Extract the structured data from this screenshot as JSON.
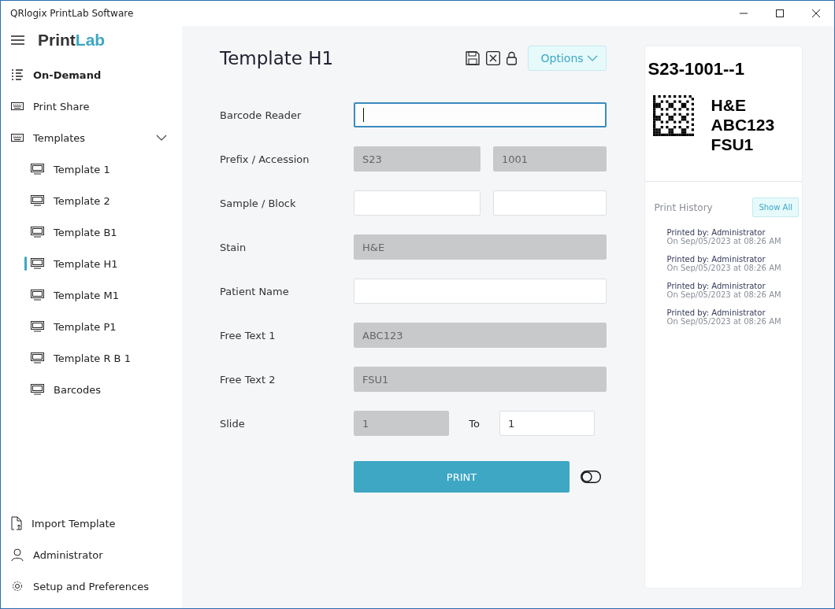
{
  "window": {
    "title": "QRlogix PrintLab Software"
  },
  "logo": {
    "dark": "Print",
    "accent": "Lab"
  },
  "nav": [
    {
      "label": "On-Demand",
      "selected": true
    },
    {
      "label": "Print Share",
      "selected": false
    },
    {
      "label": "Templates",
      "selected": false,
      "expanded": true,
      "children": [
        {
          "label": "Template 1",
          "selected": false
        },
        {
          "label": "Template 2",
          "selected": false
        },
        {
          "label": "Template B1",
          "selected": false
        },
        {
          "label": "Template H1",
          "selected": true
        },
        {
          "label": "Template M1",
          "selected": false
        },
        {
          "label": "Template P1",
          "selected": false
        },
        {
          "label": "Template R B 1",
          "selected": false
        },
        {
          "label": "Barcodes",
          "selected": false
        }
      ]
    }
  ],
  "nav_bottom": [
    {
      "label": "Import Template"
    },
    {
      "label": "Administrator"
    },
    {
      "label": "Setup and Preferences"
    }
  ],
  "form": {
    "title": "Template H1",
    "options_label": "Options",
    "rows": [
      {
        "label": "Barcode Reader",
        "kind": "single",
        "inputs": [
          {
            "disabled": false,
            "focused": true
          }
        ]
      },
      {
        "label": "Prefix / Accession",
        "kind": "pair",
        "inputs": [
          {
            "value": "S23",
            "disabled": true,
            "focused": false
          },
          {
            "value": "1001",
            "disabled": true,
            "focused": false
          }
        ]
      },
      {
        "label": "Sample / Block",
        "kind": "pair",
        "inputs": [
          {
            "disabled": false,
            "focused": false
          },
          {
            "disabled": false,
            "focused": false
          }
        ]
      },
      {
        "label": "Stain",
        "kind": "single",
        "inputs": [
          {
            "value": "H&E",
            "disabled": true,
            "focused": false
          }
        ]
      },
      {
        "label": "Patient Name",
        "kind": "single",
        "inputs": [
          {
            "disabled": false,
            "focused": false
          }
        ]
      },
      {
        "label": "Free Text 1",
        "kind": "single",
        "inputs": [
          {
            "value": "ABC123",
            "disabled": true,
            "focused": false
          }
        ]
      },
      {
        "label": "Free Text 2",
        "kind": "single",
        "inputs": [
          {
            "value": "FSU1",
            "disabled": true,
            "focused": false
          }
        ]
      },
      {
        "label": "Slide",
        "kind": "range",
        "to_label": "To",
        "inputs": [
          {
            "value": "1",
            "disabled": true,
            "focused": false
          },
          {
            "value": "1",
            "disabled": false,
            "focused": false
          }
        ]
      }
    ],
    "print_label": "PRINT",
    "toggle": {
      "on": false
    }
  },
  "preview": {
    "title": "S23-1001--1",
    "lines": [
      "H&E",
      "ABC123",
      "FSU1"
    ]
  },
  "history": {
    "title": "Print History",
    "show_all": "Show All",
    "entries": [
      {
        "by": "Printed by: Administrator",
        "when": "On Sep/05/2023 at 08:26 AM"
      },
      {
        "by": "Printed by: Administrator",
        "when": "On Sep/05/2023 at 08:26 AM"
      },
      {
        "by": "Printed by: Administrator",
        "when": "On Sep/05/2023 at 08:26 AM"
      },
      {
        "by": "Printed by: Administrator",
        "when": "On Sep/05/2023 at 08:26 AM"
      }
    ]
  }
}
